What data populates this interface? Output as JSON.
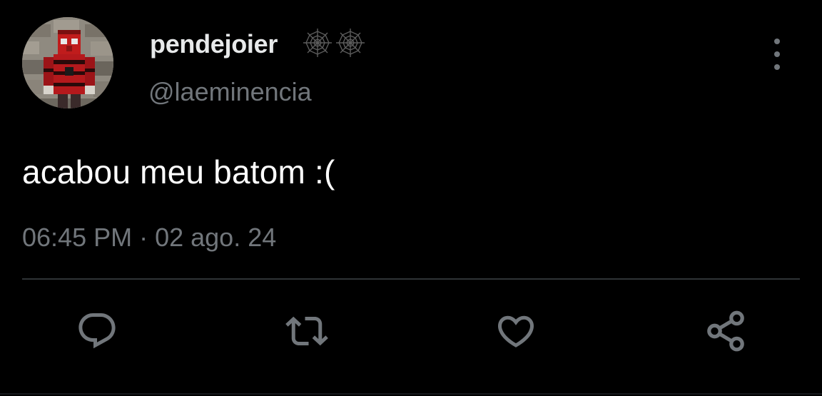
{
  "tweet": {
    "display_name": "pendejoier",
    "badges": [
      "spiderweb-icon",
      "spiderweb-icon"
    ],
    "handle": "@laeminencia",
    "text": "acabou meu batom :(",
    "time": "06:45 PM",
    "separator": "·",
    "date": "02 ago. 24"
  },
  "actions": [
    "reply-icon",
    "retweet-icon",
    "like-icon",
    "share-icon"
  ],
  "colors": {
    "background": "#000000",
    "primary_text": "#e7e9ea",
    "secondary_text": "#71767b",
    "divider": "#2f3336"
  }
}
